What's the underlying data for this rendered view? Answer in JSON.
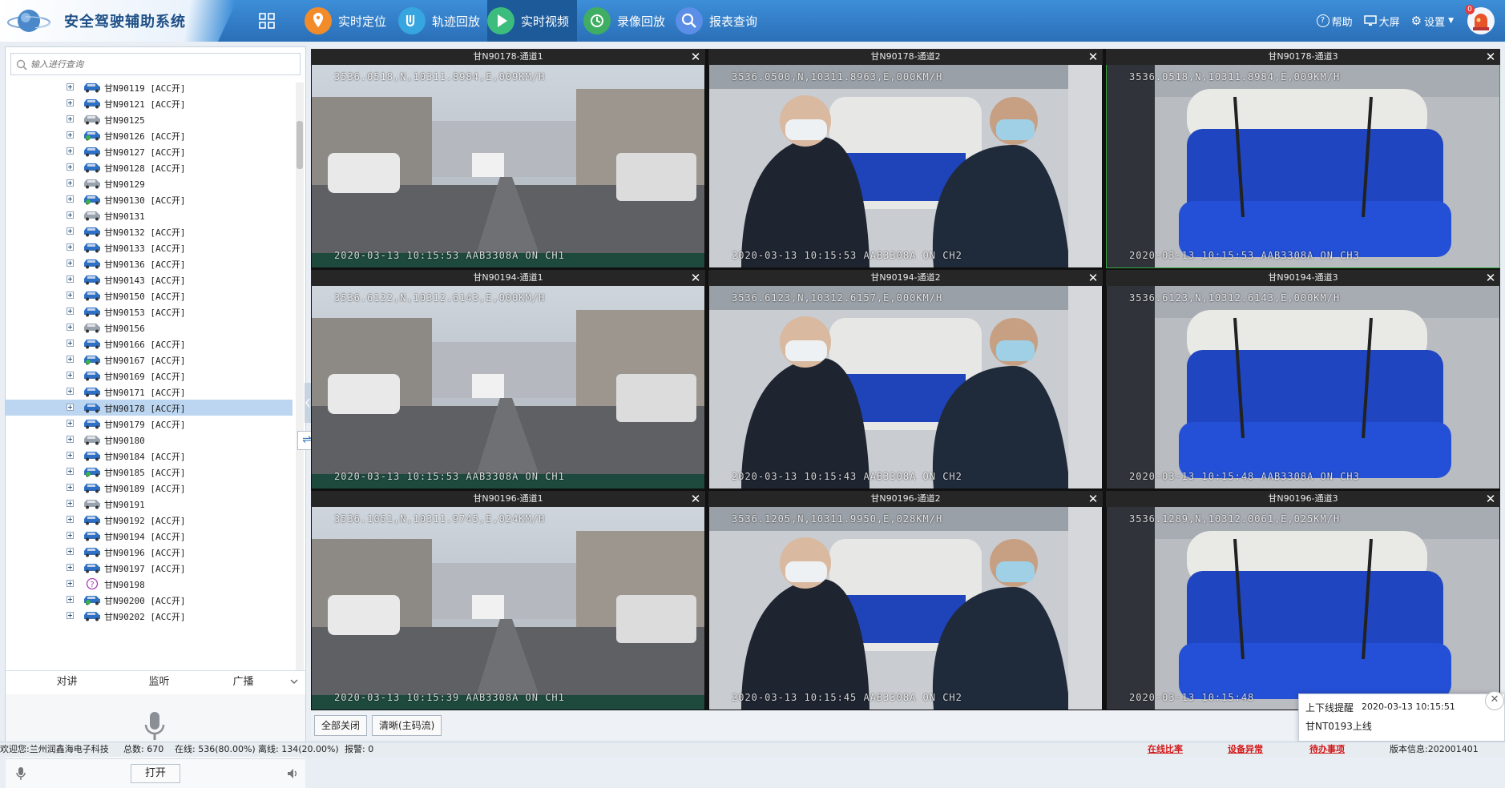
{
  "app": {
    "title": "安全驾驶辅助系统"
  },
  "nav": [
    {
      "label": "实时定位",
      "icon": "location-pin-icon",
      "color": "#f28c2b"
    },
    {
      "label": "轨迹回放",
      "icon": "track-icon",
      "color": "#36a5e0"
    },
    {
      "label": "实时视频",
      "icon": "play-icon",
      "color": "#3dbd7d"
    },
    {
      "label": "录像回放",
      "icon": "replay-icon",
      "color": "#3fae62"
    },
    {
      "label": "报表查询",
      "icon": "search-icon",
      "color": "#5b8ee6"
    }
  ],
  "header_tools": {
    "help": "帮助",
    "bigscreen": "大屏",
    "settings": "设置",
    "alarm_count": "0"
  },
  "search": {
    "placeholder": "输入进行查询"
  },
  "tree": [
    {
      "label": "甘N90119 [ACC开]",
      "status": "online"
    },
    {
      "label": "甘N90121 [ACC开]",
      "status": "online"
    },
    {
      "label": "甘N90125",
      "status": "offline"
    },
    {
      "label": "甘N90126 [ACC开]",
      "status": "online-alt"
    },
    {
      "label": "甘N90127 [ACC开]",
      "status": "online"
    },
    {
      "label": "甘N90128 [ACC开]",
      "status": "online"
    },
    {
      "label": "甘N90129",
      "status": "offline"
    },
    {
      "label": "甘N90130 [ACC开]",
      "status": "online-alt"
    },
    {
      "label": "甘N90131",
      "status": "offline"
    },
    {
      "label": "甘N90132 [ACC开]",
      "status": "online"
    },
    {
      "label": "甘N90133 [ACC开]",
      "status": "online"
    },
    {
      "label": "甘N90136 [ACC开]",
      "status": "online"
    },
    {
      "label": "甘N90143 [ACC开]",
      "status": "online"
    },
    {
      "label": "甘N90150 [ACC开]",
      "status": "online"
    },
    {
      "label": "甘N90153 [ACC开]",
      "status": "online"
    },
    {
      "label": "甘N90156",
      "status": "offline"
    },
    {
      "label": "甘N90166 [ACC开]",
      "status": "online"
    },
    {
      "label": "甘N90167 [ACC开]",
      "status": "online-alt"
    },
    {
      "label": "甘N90169 [ACC开]",
      "status": "online"
    },
    {
      "label": "甘N90171 [ACC开]",
      "status": "online"
    },
    {
      "label": "甘N90178 [ACC开]",
      "status": "online",
      "selected": true
    },
    {
      "label": "甘N90179 [ACC开]",
      "status": "online"
    },
    {
      "label": "甘N90180",
      "status": "offline"
    },
    {
      "label": "甘N90184 [ACC开]",
      "status": "online"
    },
    {
      "label": "甘N90185 [ACC开]",
      "status": "online-alt"
    },
    {
      "label": "甘N90189 [ACC开]",
      "status": "online"
    },
    {
      "label": "甘N90191",
      "status": "offline"
    },
    {
      "label": "甘N90192 [ACC开]",
      "status": "online"
    },
    {
      "label": "甘N90194 [ACC开]",
      "status": "online"
    },
    {
      "label": "甘N90196 [ACC开]",
      "status": "online"
    },
    {
      "label": "甘N90197 [ACC开]",
      "status": "online"
    },
    {
      "label": "甘N90198",
      "status": "unknown"
    },
    {
      "label": "甘N90200 [ACC开]",
      "status": "online-alt"
    },
    {
      "label": "甘N90202 [ACC开]",
      "status": "online"
    }
  ],
  "tabs": [
    "对讲",
    "监听",
    "广播"
  ],
  "open_button": "打开",
  "videos": [
    {
      "title": "甘N90178-通道1",
      "osd_top": "3536.0518,N,10311.8984,E,009KM/H",
      "osd_bottom": "2020-03-13 10:15:53 AAB3308A ON  CH1",
      "scene": "road"
    },
    {
      "title": "甘N90178-通道2",
      "osd_top": "3536.0500,N,10311.8963,E,000KM/H",
      "osd_bottom": "2020-03-13 10:15:53 AAB3308A ON  CH2",
      "scene": "cabin-front"
    },
    {
      "title": "甘N90178-通道3",
      "osd_top": "3536.0518,N,10311.8984,E,009KM/H",
      "osd_bottom": "2020-03-13 10:15:53 AAB3308A ON  CH3",
      "scene": "cabin-rear",
      "selected": true
    },
    {
      "title": "甘N90194-通道1",
      "osd_top": "3536.6122,N,10312.6143,E,000KM/H",
      "osd_bottom": "2020-03-13 10:15:53 AAB3308A ON  CH1",
      "scene": "road"
    },
    {
      "title": "甘N90194-通道2",
      "osd_top": "3536.6123,N,10312.6157,E,000KM/H",
      "osd_bottom": "2020-03-13 10:15:43 AAB3308A ON  CH2",
      "scene": "cabin-front"
    },
    {
      "title": "甘N90194-通道3",
      "osd_top": "3536.6123,N,10312.6143,E,000KM/H",
      "osd_bottom": "2020-03-13 10:15:48 AAB3308A ON  CH3",
      "scene": "cabin-rear"
    },
    {
      "title": "甘N90196-通道1",
      "osd_top": "3536.1051,N,10311.9745,E,024KM/H",
      "osd_bottom": "2020-03-13 10:15:39 AAB3308A ON  CH1",
      "scene": "road"
    },
    {
      "title": "甘N90196-通道2",
      "osd_top": "3536.1205,N,10311.9950,E,028KM/H",
      "osd_bottom": "2020-03-13 10:15:45 AAB3308A ON  CH2",
      "scene": "cabin-front"
    },
    {
      "title": "甘N90196-通道3",
      "osd_top": "3536.1289,N,10312.0061,E,025KM/H",
      "osd_bottom": "2020-03-13 10:15:48",
      "scene": "cabin-rear"
    }
  ],
  "toolbar": {
    "close_all": "全部关闭",
    "stream": "清晰(主码流)"
  },
  "notification": {
    "title": "上下线提醒",
    "time": "2020-03-13 10:15:51",
    "message": "甘NT0193上线"
  },
  "status": {
    "welcome": "欢迎您:兰州润鑫海电子科技",
    "total": "总数: 670",
    "online": "在线: 536(80.00%)",
    "offline": "离线: 134(20.00%)",
    "alarm": "报警: 0",
    "links": [
      "在线比率",
      "设备异常",
      "待办事项"
    ],
    "version": "版本信息:202001401"
  }
}
